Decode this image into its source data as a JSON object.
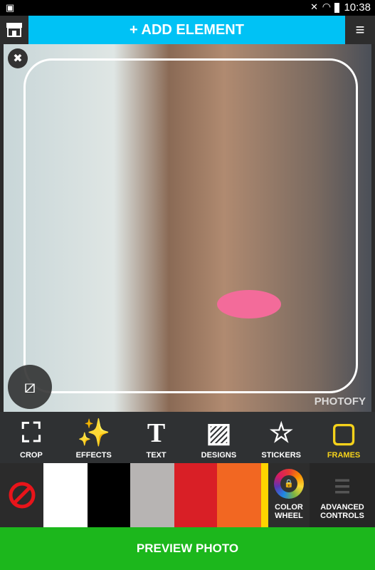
{
  "status_bar": {
    "time": "10:38",
    "icons": [
      "image-icon",
      "mute-icon",
      "wifi-icon",
      "battery-icon"
    ]
  },
  "header": {
    "add_label": "+ ADD ELEMENT",
    "store_icon": "store-icon",
    "menu_icon": "hamburger-menu-icon"
  },
  "photo": {
    "watermark": "PHOTOFY"
  },
  "tools": [
    {
      "label": "CROP",
      "icon": "crop-icon"
    },
    {
      "label": "EFFECTS",
      "icon": "magic-wand-icon"
    },
    {
      "label": "TEXT",
      "icon": "text-icon"
    },
    {
      "label": "DESIGNS",
      "icon": "designs-icon"
    },
    {
      "label": "STICKERS",
      "icon": "star-sticker-icon"
    },
    {
      "label": "FRAMES",
      "icon": "frame-icon",
      "active": true
    }
  ],
  "colors": {
    "swatches": [
      "#ffffff",
      "#000000",
      "#b7b4b3",
      "#d91f26",
      "#f26722"
    ],
    "selected_indicator": "#ffd400"
  },
  "color_wheel": {
    "label_1": "COLOR",
    "label_2": "WHEEL"
  },
  "advanced": {
    "label_1": "ADVANCED",
    "label_2": "CONTROLS"
  },
  "preview_label": "PREVIEW PHOTO"
}
